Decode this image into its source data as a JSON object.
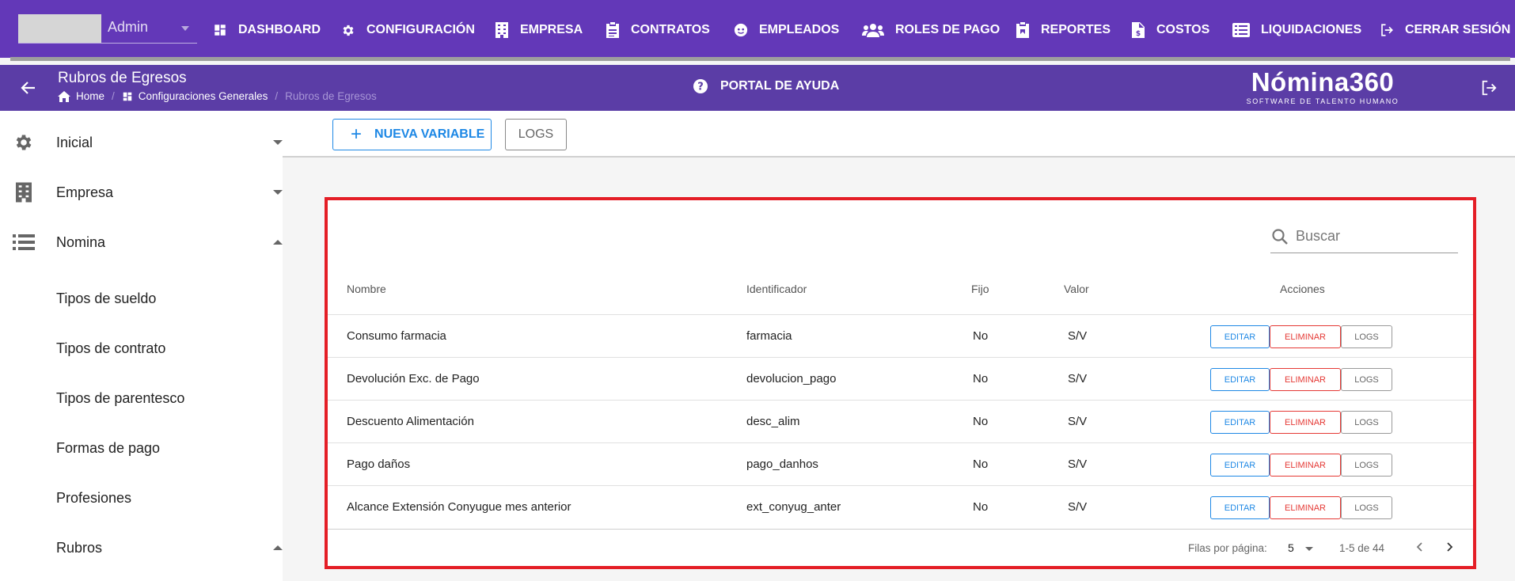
{
  "user": {
    "name": "Admin"
  },
  "nav": [
    {
      "label": "DASHBOARD",
      "icon": "dashboard-icon"
    },
    {
      "label": "CONFIGURACIÓN",
      "icon": "gear-icon"
    },
    {
      "label": "EMPRESA",
      "icon": "building-icon"
    },
    {
      "label": "CONTRATOS",
      "icon": "clipboard-icon"
    },
    {
      "label": "EMPLEADOS",
      "icon": "face-icon"
    },
    {
      "label": "ROLES DE PAGO",
      "icon": "group-icon"
    },
    {
      "label": "REPORTES",
      "icon": "report-icon"
    },
    {
      "label": "COSTOS",
      "icon": "invoice-icon"
    },
    {
      "label": "LIQUIDACIONES",
      "icon": "list-icon"
    },
    {
      "label": "CERRAR SESIÓN",
      "icon": "logout-icon"
    }
  ],
  "header": {
    "title": "Rubros de Egresos",
    "breadcrumb": [
      "Home",
      "Configuraciones Generales",
      "Rubros de Egresos"
    ],
    "help": "PORTAL DE AYUDA",
    "logo": "Nómina360",
    "logo_tagline": "SOFTWARE DE TALENTO HUMANO"
  },
  "sidebar": {
    "items": [
      {
        "label": "Inicial",
        "icon": "gear-icon",
        "state": "collapsed"
      },
      {
        "label": "Empresa",
        "icon": "building-icon",
        "state": "collapsed"
      },
      {
        "label": "Nomina",
        "icon": "list-icon",
        "state": "expanded"
      }
    ],
    "sub_items": [
      "Tipos de sueldo",
      "Tipos de contrato",
      "Tipos de parentesco",
      "Formas de pago",
      "Profesiones"
    ],
    "group": {
      "label": "Rubros",
      "state": "expanded"
    }
  },
  "toolbar": {
    "new_label": "NUEVA VARIABLE",
    "logs_label": "LOGS"
  },
  "search": {
    "placeholder": "Buscar"
  },
  "table": {
    "columns": [
      "Nombre",
      "Identificador",
      "Fijo",
      "Valor",
      "Acciones"
    ],
    "rows": [
      {
        "nombre": "Consumo farmacia",
        "identificador": "farmacia",
        "fijo": "No",
        "valor": "S/V"
      },
      {
        "nombre": "Devolución Exc. de Pago",
        "identificador": "devolucion_pago",
        "fijo": "No",
        "valor": "S/V"
      },
      {
        "nombre": "Descuento Alimentación",
        "identificador": "desc_alim",
        "fijo": "No",
        "valor": "S/V"
      },
      {
        "nombre": "Pago daños",
        "identificador": "pago_danhos",
        "fijo": "No",
        "valor": "S/V"
      },
      {
        "nombre": "Alcance Extensión Conyugue mes anterior",
        "identificador": "ext_conyug_anter",
        "fijo": "No",
        "valor": "S/V"
      }
    ],
    "actions": {
      "edit": "EDITAR",
      "delete": "ELIMINAR",
      "logs": "LOGS"
    }
  },
  "pagination": {
    "rows_per_page_label": "Filas por página:",
    "rows_per_page": "5",
    "range": "1-5 de 44"
  },
  "colors": {
    "topbar": "#6338b8",
    "header": "#5b3da6",
    "accent": "#1e88e5",
    "danger": "#e53935",
    "highlight": "#e41e26"
  }
}
